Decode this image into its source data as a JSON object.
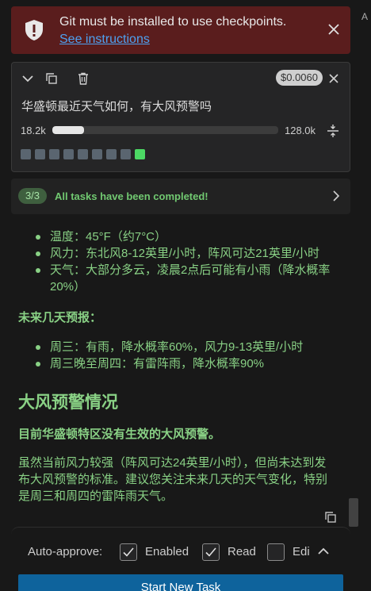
{
  "edge_letter": "A",
  "error_banner": {
    "icon": "shield-alert-icon",
    "title": "Git must be installed to use checkpoints.",
    "link_text": "See instructions",
    "close_icon": "close-icon",
    "background": "#5a1d1d"
  },
  "task": {
    "cost": "$0.0060",
    "text": "华盛顿最近天气如何，有大风预警吗",
    "tokens_used": "18.2k",
    "tokens_max": "128.0k",
    "usage_fraction": 0.142,
    "checkpoint_count": 9,
    "active_checkpoint_index": 8,
    "icons": [
      "chevron-down-icon",
      "copy-icon",
      "trash-icon",
      "close-icon",
      "compress-icon"
    ]
  },
  "completion": {
    "badge": "3/3",
    "text": "All tasks have been completed!",
    "accent": "#71c971"
  },
  "message": {
    "weather_list": [
      "温度：45°F（约7°C）",
      "风力：东北风8-12英里/小时，阵风可达21英里/小时",
      "天气：大部分多云，凌晨2点后可能有小雨（降水概率20%）"
    ],
    "forecast_heading": "未来几天预报：",
    "forecast_list": [
      "周三：有雨，降水概率60%，风力9-13英里/小时",
      "周三晚至周四：有雷阵雨，降水概率90%"
    ],
    "wind_heading": "大风预警情况",
    "wind_status": "目前华盛顿特区没有生效的大风预警。",
    "wind_note": "虽然当前风力较强（阵风可达24英里/小时），但尚未达到发布大风预警的标准。建议您关注未来几天的天气变化，特别是周三和周四的雷阵雨天气。",
    "text_color": "#89d185"
  },
  "auto_approve": {
    "label": "Auto-approve:",
    "options": [
      {
        "label": "Enabled",
        "checked": true
      },
      {
        "label": "Read",
        "checked": true
      },
      {
        "label": "Edi",
        "checked": false
      }
    ]
  },
  "start_button": {
    "label": "Start New Task",
    "color": "#0e639c"
  }
}
